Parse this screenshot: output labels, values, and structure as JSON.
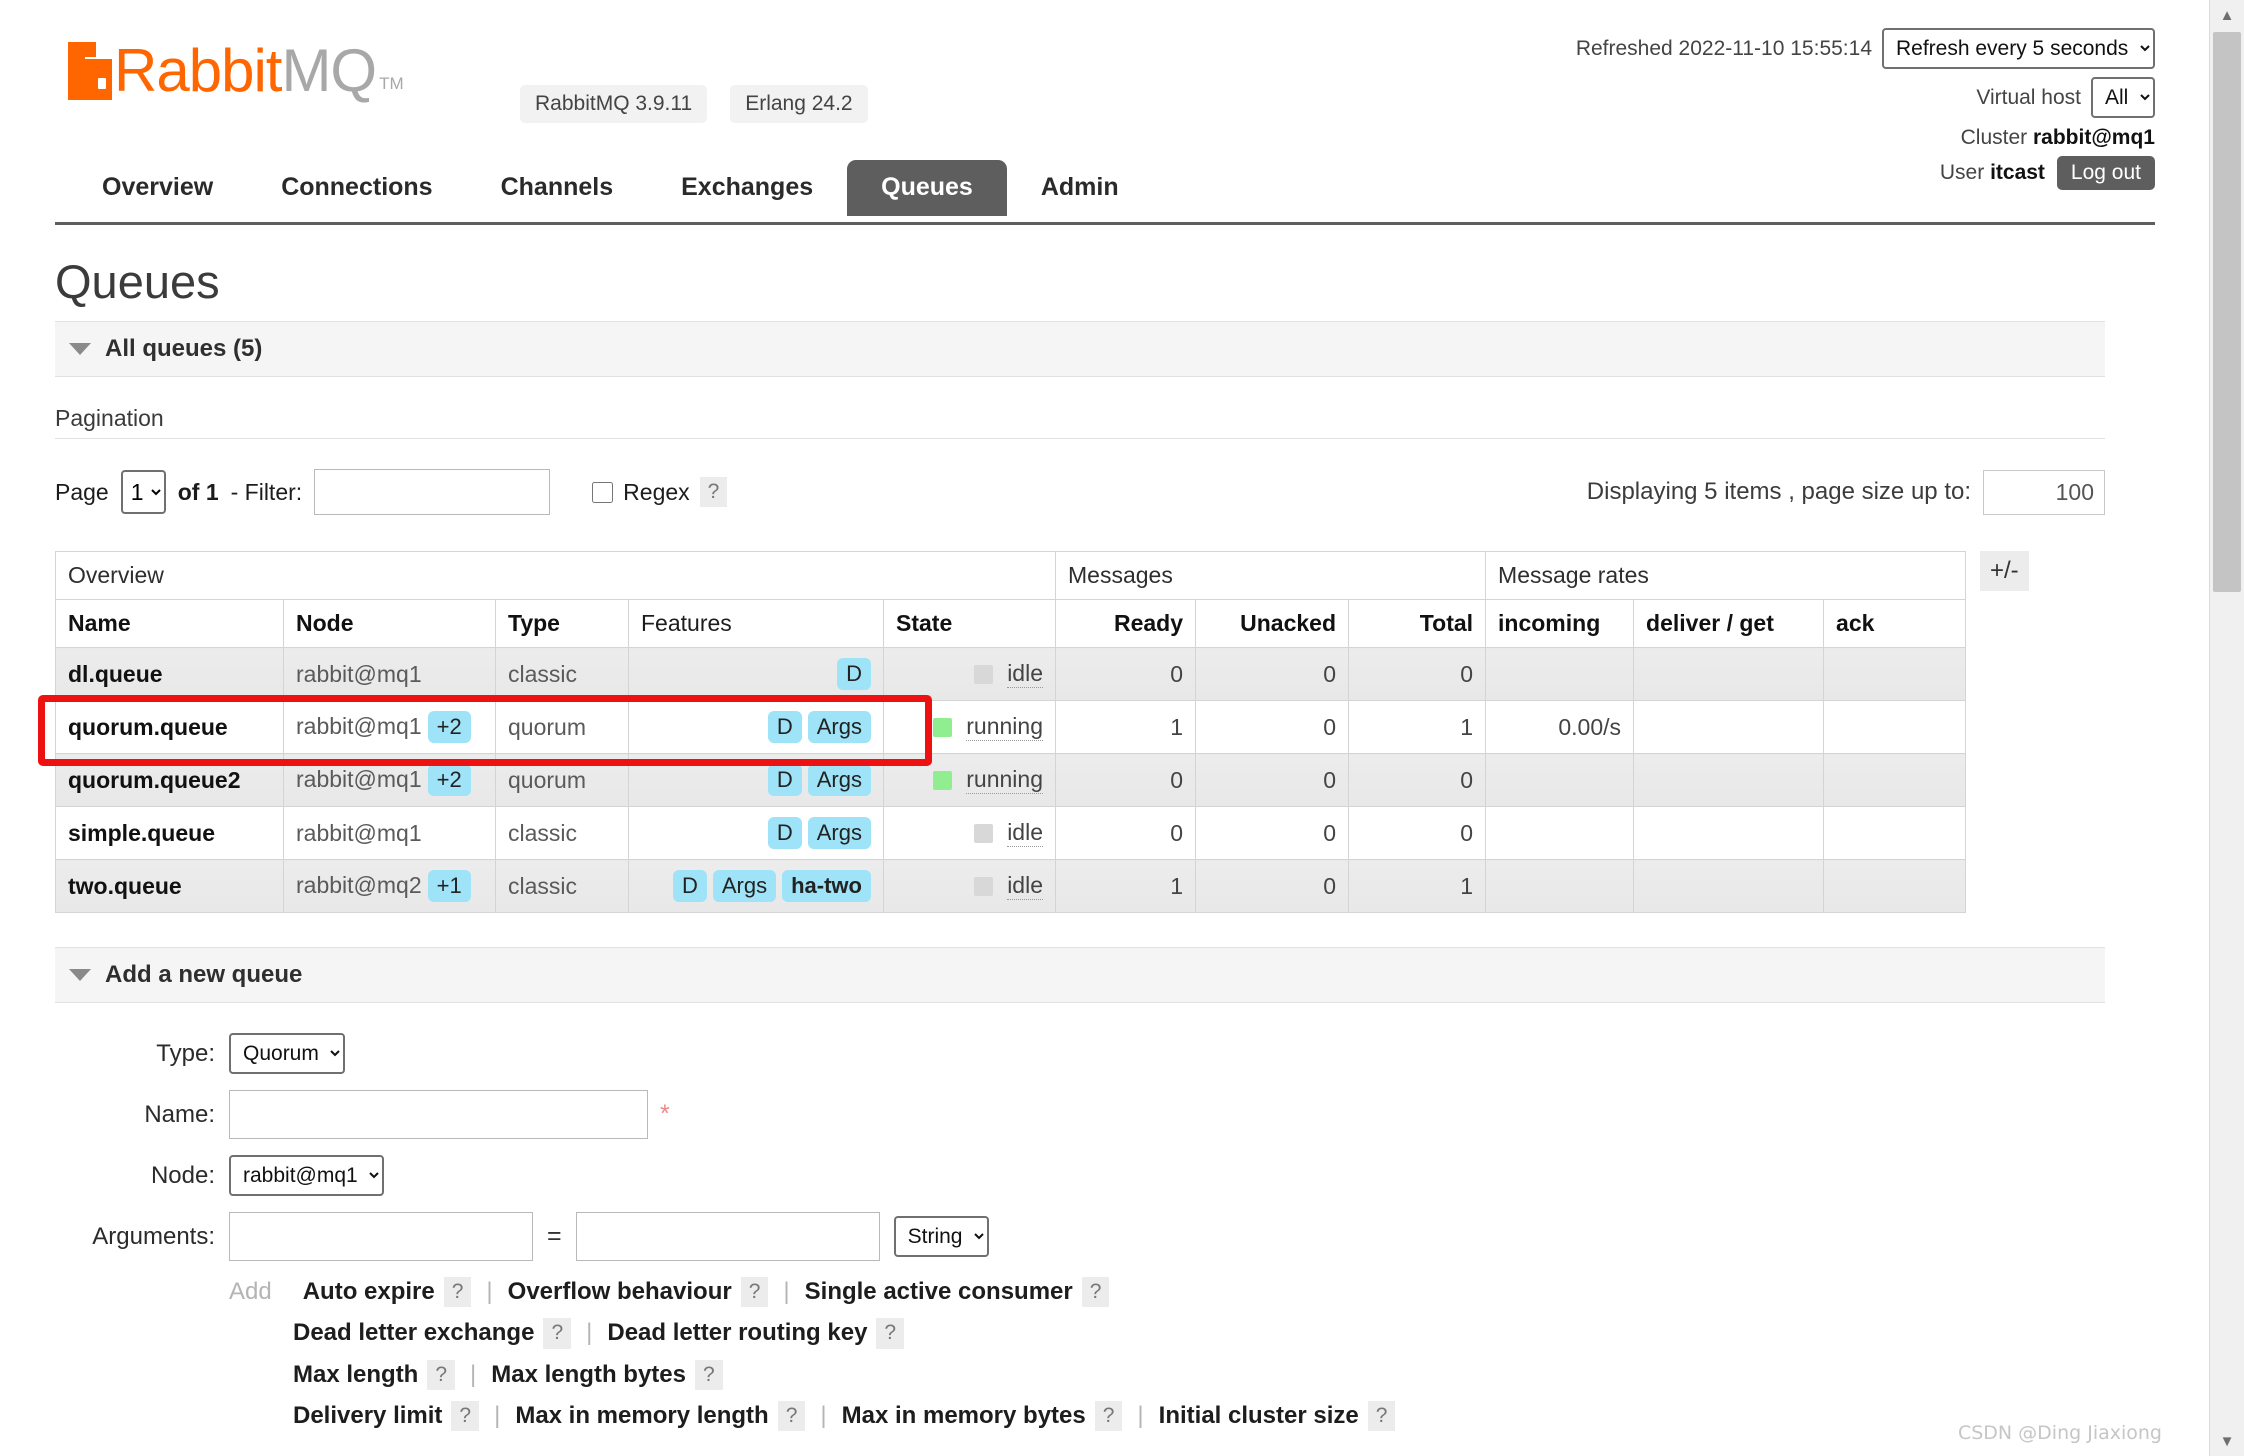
{
  "header": {
    "logo_rabbit": "Rabbit",
    "logo_mq": "MQ",
    "logo_tm": "TM",
    "version_badges": [
      "RabbitMQ 3.9.11",
      "Erlang 24.2"
    ],
    "refreshed_label": "Refreshed 2022-11-10 15:55:14",
    "refresh_select": "Refresh every 5 seconds",
    "vhost_label": "Virtual host",
    "vhost_select": "All",
    "cluster_label": "Cluster",
    "cluster_value": "rabbit@mq1",
    "user_label": "User",
    "user_value": "itcast",
    "logout_label": "Log out"
  },
  "nav": {
    "tabs": [
      {
        "label": "Overview",
        "active": false
      },
      {
        "label": "Connections",
        "active": false
      },
      {
        "label": "Channels",
        "active": false
      },
      {
        "label": "Exchanges",
        "active": false
      },
      {
        "label": "Queues",
        "active": true
      },
      {
        "label": "Admin",
        "active": false
      }
    ]
  },
  "main": {
    "page_title": "Queues",
    "all_queues_section": "All queues (5)",
    "pagination_label": "Pagination",
    "page_word": "Page",
    "page_value": "1",
    "of_text": "of 1",
    "filter_label": "- Filter:",
    "filter_value": "",
    "regex_label": "Regex",
    "help_glyph": "?",
    "displaying_text": "Displaying 5 items , page size up to:",
    "page_size_value": "100",
    "plus_minus": "+/-"
  },
  "table": {
    "group_headers": [
      "Overview",
      "Messages",
      "Message rates"
    ],
    "columns": [
      "Name",
      "Node",
      "Type",
      "Features",
      "State",
      "Ready",
      "Unacked",
      "Total",
      "incoming",
      "deliver / get",
      "ack"
    ],
    "rows": [
      {
        "name": "dl.queue",
        "node": "rabbit@mq1",
        "node_extra": "",
        "type": "classic",
        "features": [
          "D"
        ],
        "state": "idle",
        "state_color": "grey",
        "ready": "0",
        "unacked": "0",
        "total": "0",
        "incoming": "",
        "deliver_get": "",
        "ack": ""
      },
      {
        "name": "quorum.queue",
        "node": "rabbit@mq1",
        "node_extra": "+2",
        "type": "quorum",
        "features": [
          "D",
          "Args"
        ],
        "state": "running",
        "state_color": "green",
        "ready": "1",
        "unacked": "0",
        "total": "1",
        "incoming": "0.00/s",
        "deliver_get": "",
        "ack": ""
      },
      {
        "name": "quorum.queue2",
        "node": "rabbit@mq1",
        "node_extra": "+2",
        "type": "quorum",
        "features": [
          "D",
          "Args"
        ],
        "state": "running",
        "state_color": "green",
        "ready": "0",
        "unacked": "0",
        "total": "0",
        "incoming": "",
        "deliver_get": "",
        "ack": ""
      },
      {
        "name": "simple.queue",
        "node": "rabbit@mq1",
        "node_extra": "",
        "type": "classic",
        "features": [
          "D",
          "Args"
        ],
        "state": "idle",
        "state_color": "grey",
        "ready": "0",
        "unacked": "0",
        "total": "0",
        "incoming": "",
        "deliver_get": "",
        "ack": ""
      },
      {
        "name": "two.queue",
        "node": "rabbit@mq2",
        "node_extra": "+1",
        "type": "classic",
        "features": [
          "D",
          "Args",
          "ha-two"
        ],
        "state": "idle",
        "state_color": "grey",
        "ready": "1",
        "unacked": "0",
        "total": "1",
        "incoming": "",
        "deliver_get": "",
        "ack": ""
      }
    ]
  },
  "add_queue": {
    "section_title": "Add a new queue",
    "type_label": "Type:",
    "type_value": "Quorum",
    "name_label": "Name:",
    "name_value": "",
    "required_marker": "*",
    "node_label": "Node:",
    "node_value": "rabbit@mq1",
    "arguments_label": "Arguments:",
    "argument_key": "",
    "argument_value": "",
    "argument_type": "String",
    "equals": "=",
    "add_label": "Add",
    "preset_rows": [
      [
        "Auto expire",
        "Overflow behaviour",
        "Single active consumer"
      ],
      [
        "Dead letter exchange",
        "Dead letter routing key"
      ],
      [
        "Max length",
        "Max length bytes"
      ],
      [
        "Delivery limit",
        "Max in memory length",
        "Max in memory bytes",
        "Initial cluster size"
      ]
    ]
  },
  "annotation": {
    "highlight_row": "quorum.queue2",
    "color": "#ee1111"
  },
  "watermark": "CSDN @Ding Jiaxiong",
  "icons": {
    "caret_down": "caret-down-icon",
    "scroll_up": "▲",
    "scroll_down": "▼"
  }
}
